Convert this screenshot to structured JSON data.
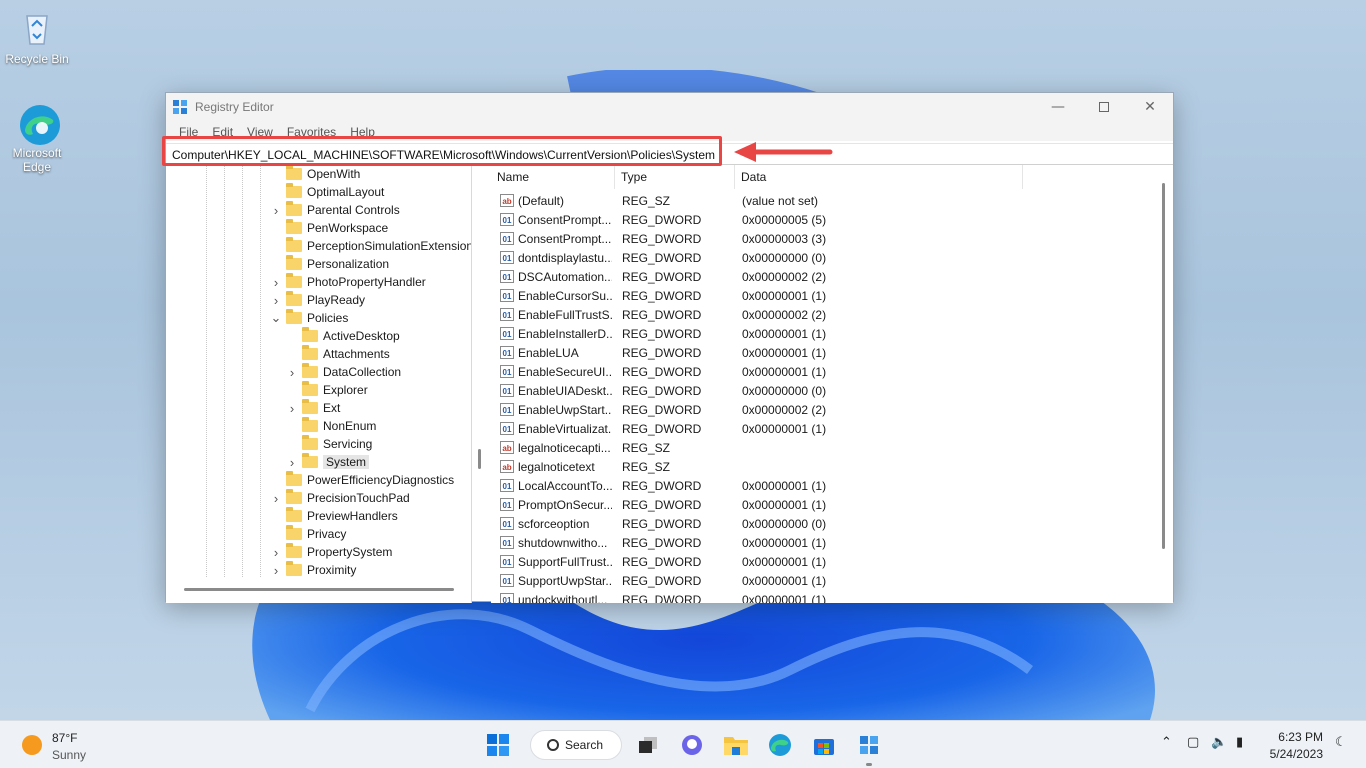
{
  "desktop": {
    "icons": [
      {
        "label": "Recycle Bin",
        "icon": "recycle-bin-icon"
      },
      {
        "label": "Microsoft Edge",
        "icon": "edge-icon"
      }
    ]
  },
  "window": {
    "title": "Registry Editor",
    "menu": [
      "File",
      "Edit",
      "View",
      "Favorites",
      "Help"
    ],
    "address": "Computer\\HKEY_LOCAL_MACHINE\\SOFTWARE\\Microsoft\\Windows\\CurrentVersion\\Policies\\System",
    "highlight_color": "#e84545"
  },
  "tree": [
    {
      "label": "OpenWith",
      "level": 1,
      "expander": ""
    },
    {
      "label": "OptimalLayout",
      "level": 1,
      "expander": ""
    },
    {
      "label": "Parental Controls",
      "level": 1,
      "expander": "collapsed"
    },
    {
      "label": "PenWorkspace",
      "level": 1,
      "expander": ""
    },
    {
      "label": "PerceptionSimulationExtensions",
      "level": 1,
      "expander": ""
    },
    {
      "label": "Personalization",
      "level": 1,
      "expander": ""
    },
    {
      "label": "PhotoPropertyHandler",
      "level": 1,
      "expander": "collapsed"
    },
    {
      "label": "PlayReady",
      "level": 1,
      "expander": "collapsed"
    },
    {
      "label": "Policies",
      "level": 1,
      "expander": "expanded"
    },
    {
      "label": "ActiveDesktop",
      "level": 2,
      "expander": ""
    },
    {
      "label": "Attachments",
      "level": 2,
      "expander": ""
    },
    {
      "label": "DataCollection",
      "level": 2,
      "expander": "collapsed"
    },
    {
      "label": "Explorer",
      "level": 2,
      "expander": ""
    },
    {
      "label": "Ext",
      "level": 2,
      "expander": "collapsed"
    },
    {
      "label": "NonEnum",
      "level": 2,
      "expander": ""
    },
    {
      "label": "Servicing",
      "level": 2,
      "expander": ""
    },
    {
      "label": "System",
      "level": 2,
      "expander": "collapsed",
      "selected": true
    },
    {
      "label": "PowerEfficiencyDiagnostics",
      "level": 1,
      "expander": ""
    },
    {
      "label": "PrecisionTouchPad",
      "level": 1,
      "expander": "collapsed"
    },
    {
      "label": "PreviewHandlers",
      "level": 1,
      "expander": ""
    },
    {
      "label": "Privacy",
      "level": 1,
      "expander": ""
    },
    {
      "label": "PropertySystem",
      "level": 1,
      "expander": "collapsed"
    },
    {
      "label": "Proximity",
      "level": 1,
      "expander": "collapsed"
    }
  ],
  "columns": {
    "name": "Name",
    "type": "Type",
    "data": "Data"
  },
  "values": [
    {
      "name": "(Default)",
      "type": "REG_SZ",
      "data": "(value not set)",
      "kind": "sz"
    },
    {
      "name": "ConsentPrompt...",
      "type": "REG_DWORD",
      "data": "0x00000005 (5)",
      "kind": "dword"
    },
    {
      "name": "ConsentPrompt...",
      "type": "REG_DWORD",
      "data": "0x00000003 (3)",
      "kind": "dword"
    },
    {
      "name": "dontdisplaylastu...",
      "type": "REG_DWORD",
      "data": "0x00000000 (0)",
      "kind": "dword"
    },
    {
      "name": "DSCAutomation...",
      "type": "REG_DWORD",
      "data": "0x00000002 (2)",
      "kind": "dword"
    },
    {
      "name": "EnableCursorSu...",
      "type": "REG_DWORD",
      "data": "0x00000001 (1)",
      "kind": "dword"
    },
    {
      "name": "EnableFullTrustS...",
      "type": "REG_DWORD",
      "data": "0x00000002 (2)",
      "kind": "dword"
    },
    {
      "name": "EnableInstallerD...",
      "type": "REG_DWORD",
      "data": "0x00000001 (1)",
      "kind": "dword"
    },
    {
      "name": "EnableLUA",
      "type": "REG_DWORD",
      "data": "0x00000001 (1)",
      "kind": "dword"
    },
    {
      "name": "EnableSecureUI...",
      "type": "REG_DWORD",
      "data": "0x00000001 (1)",
      "kind": "dword"
    },
    {
      "name": "EnableUIADeskt...",
      "type": "REG_DWORD",
      "data": "0x00000000 (0)",
      "kind": "dword"
    },
    {
      "name": "EnableUwpStart...",
      "type": "REG_DWORD",
      "data": "0x00000002 (2)",
      "kind": "dword"
    },
    {
      "name": "EnableVirtualizat...",
      "type": "REG_DWORD",
      "data": "0x00000001 (1)",
      "kind": "dword"
    },
    {
      "name": "legalnoticecapti...",
      "type": "REG_SZ",
      "data": "",
      "kind": "sz"
    },
    {
      "name": "legalnoticetext",
      "type": "REG_SZ",
      "data": "",
      "kind": "sz"
    },
    {
      "name": "LocalAccountTo...",
      "type": "REG_DWORD",
      "data": "0x00000001 (1)",
      "kind": "dword"
    },
    {
      "name": "PromptOnSecur...",
      "type": "REG_DWORD",
      "data": "0x00000001 (1)",
      "kind": "dword"
    },
    {
      "name": "scforceoption",
      "type": "REG_DWORD",
      "data": "0x00000000 (0)",
      "kind": "dword"
    },
    {
      "name": "shutdownwitho...",
      "type": "REG_DWORD",
      "data": "0x00000001 (1)",
      "kind": "dword"
    },
    {
      "name": "SupportFullTrust...",
      "type": "REG_DWORD",
      "data": "0x00000001 (1)",
      "kind": "dword"
    },
    {
      "name": "SupportUwpStar...",
      "type": "REG_DWORD",
      "data": "0x00000001 (1)",
      "kind": "dword"
    },
    {
      "name": "undockwithoutl...",
      "type": "REG_DWORD",
      "data": "0x00000001 (1)",
      "kind": "dword"
    }
  ],
  "taskbar": {
    "weather": {
      "temp": "87°F",
      "condition": "Sunny"
    },
    "search_label": "Search",
    "apps": [
      "start-icon",
      "task-view-icon",
      "chat-icon",
      "file-explorer-icon",
      "edge-icon",
      "store-icon",
      "registry-editor-icon"
    ],
    "tray": [
      "chevron-up-icon",
      "network-display-icon",
      "volume-icon",
      "battery-icon"
    ],
    "time": "6:23 PM",
    "date": "5/24/2023"
  }
}
